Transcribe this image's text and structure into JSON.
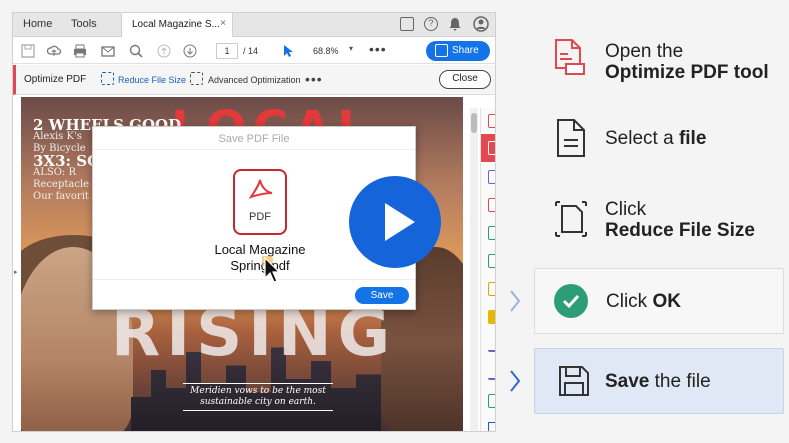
{
  "window": {
    "nav": {
      "home": "Home",
      "tools": "Tools"
    },
    "tab": {
      "title": "Local Magazine S...",
      "close": "×"
    },
    "toolbar": {
      "page_current": "1",
      "page_total": "/ 14",
      "zoom": "68.8%",
      "share_label": "Share"
    },
    "optimize_bar": {
      "title": "Optimize PDF",
      "reduce": "Reduce File Size",
      "advanced": "Advanced Optimization",
      "close": "Close"
    },
    "cover": {
      "line1": "2 WHEELS GOOD",
      "line2": "Alexis K's",
      "line3": "By Bicycle",
      "line4": "3X3: SO",
      "line5": "ALSO: R",
      "line6": "Receptacle",
      "line7": "Our favorit",
      "rising": "RISING",
      "caption": "Meridien vows to be the most sustainable city on earth."
    },
    "dialog": {
      "title": "Save PDF File",
      "file_type": "PDF",
      "file_name_1": "Local Magazine",
      "file_name_2": "Spring.pdf",
      "save": "Save"
    }
  },
  "steps": [
    {
      "line1": "Open the",
      "line2": "Optimize PDF tool",
      "icon": "optimize-pdf-icon"
    },
    {
      "pre": "Select a ",
      "bold": "file",
      "icon": "file-icon"
    },
    {
      "line1": "Click",
      "line2": "Reduce File Size",
      "icon": "reduce-file-size-icon"
    },
    {
      "pre": "Click ",
      "bold": "OK",
      "icon": "check-icon"
    },
    {
      "bold": "Save",
      "post": " the file",
      "icon": "save-icon"
    }
  ],
  "colors": {
    "accent_blue": "#1473e6",
    "acrobat_red": "#e34850",
    "check_green": "#2d9d78",
    "active_step_bg": "#dfe8f4"
  }
}
